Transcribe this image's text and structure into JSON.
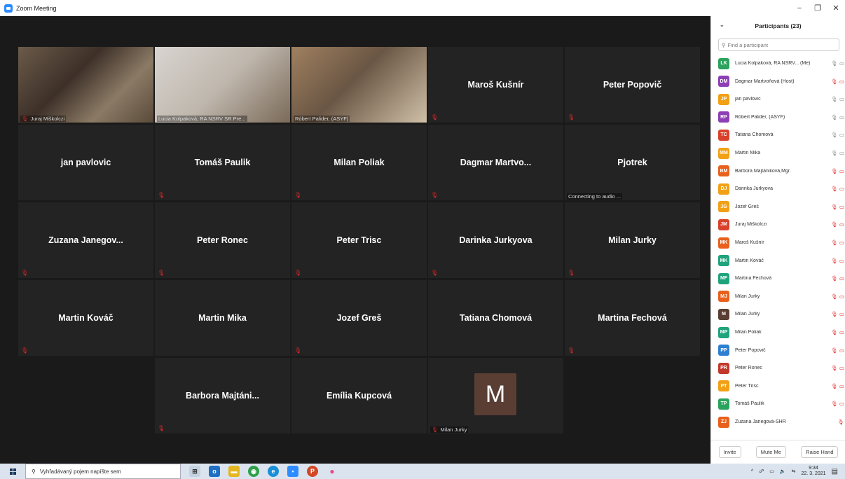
{
  "window": {
    "title": "Zoom Meeting"
  },
  "gallery": {
    "tiles": [
      {
        "kind": "video",
        "caption": "Juraj Miškolczi",
        "muted": true
      },
      {
        "kind": "video",
        "caption": "Lucia Kolpaková, RA NSRV SR Pre...",
        "muted": false
      },
      {
        "kind": "video",
        "caption": "Róbert Palider, (ASYF)",
        "muted": false,
        "active": true
      },
      {
        "kind": "name",
        "name": "Maroš Kušnír",
        "muted": true
      },
      {
        "kind": "name",
        "name": "Peter Popovič",
        "muted": true
      },
      {
        "kind": "name",
        "name": "jan pavlovic",
        "muted": false
      },
      {
        "kind": "name",
        "name": "Tomáš Paulik",
        "muted": true
      },
      {
        "kind": "name",
        "name": "Milan Poliak",
        "muted": true
      },
      {
        "kind": "name",
        "name": "Dagmar Martvo...",
        "muted": true
      },
      {
        "kind": "name",
        "name": "Pjotrek",
        "muted": false,
        "status": "Connecting to audio ..."
      },
      {
        "kind": "name",
        "name": "Zuzana Janegov...",
        "muted": true
      },
      {
        "kind": "name",
        "name": "Peter Ronec",
        "muted": true
      },
      {
        "kind": "name",
        "name": "Peter Trisc",
        "muted": true
      },
      {
        "kind": "name",
        "name": "Darinka Jurkyova",
        "muted": true
      },
      {
        "kind": "name",
        "name": "Milan Jurky",
        "muted": true
      },
      {
        "kind": "name",
        "name": "Martin Kováč",
        "muted": true
      },
      {
        "kind": "name",
        "name": "Martin Mika",
        "muted": false
      },
      {
        "kind": "name",
        "name": "Jozef Greš",
        "muted": true
      },
      {
        "kind": "name",
        "name": "Tatiana Chomová",
        "muted": false
      },
      {
        "kind": "name",
        "name": "Martina Fechová",
        "muted": true
      },
      {
        "kind": "name",
        "name": "Barbora Majtáni...",
        "muted": true
      },
      {
        "kind": "name",
        "name": "Emília Kupcová",
        "muted": false
      },
      {
        "kind": "avatar",
        "letter": "M",
        "caption": "Milan Jurky",
        "muted": true
      }
    ]
  },
  "participants": {
    "title": "Participants (23)",
    "search_placeholder": "Find a participant",
    "list": [
      {
        "initials": "LK",
        "color": "#2aa35c",
        "name": "Lucia Kolpaková, RA NSRV... (Me)",
        "icons": "🎙 ▭",
        "muted": false
      },
      {
        "initials": "DM",
        "color": "#8e3fb5",
        "name": "Dagmar Martvoňová (Host)",
        "icons": "🎙 ▭",
        "muted": true
      },
      {
        "initials": "JP",
        "color": "#f2a016",
        "name": "jan pavlovic",
        "icons": "🎙 ▭",
        "muted": false
      },
      {
        "initials": "RP",
        "color": "#8e3fb5",
        "name": "Róbert Palider, (ASYF)",
        "icons": "🎙 ▭",
        "muted": false
      },
      {
        "initials": "TC",
        "color": "#d9412b",
        "name": "Tatiana Chomová",
        "icons": "🎙 ▭",
        "muted": false
      },
      {
        "initials": "MM",
        "color": "#f2a016",
        "name": "Martin Mika",
        "icons": "🎙 ▭",
        "muted": false
      },
      {
        "initials": "BM",
        "color": "#e8601c",
        "name": "Barbora Majtániková,Mgr.",
        "icons": "🎙 ▭",
        "muted": true
      },
      {
        "initials": "DJ",
        "color": "#f2a016",
        "name": "Darinka Jurkyova",
        "icons": "🎙 ▭",
        "muted": true
      },
      {
        "initials": "JG",
        "color": "#f2a016",
        "name": "Jozef Greš",
        "icons": "🎙 ▭",
        "muted": true
      },
      {
        "initials": "JM",
        "color": "#d9412b",
        "name": "Juraj Miškolczi",
        "icons": "🎙 ▭",
        "muted": true
      },
      {
        "initials": "MK",
        "color": "#e8601c",
        "name": "Maroš Kušnír",
        "icons": "🎙 ▭",
        "muted": true
      },
      {
        "initials": "MK",
        "color": "#1fa37c",
        "name": "Martin Kováč",
        "icons": "🎙 ▭",
        "muted": true
      },
      {
        "initials": "MF",
        "color": "#1fa37c",
        "name": "Martina Fechová",
        "icons": "🎙 ▭",
        "muted": true
      },
      {
        "initials": "MJ",
        "color": "#e8601c",
        "name": "Milan Jurky",
        "icons": "🎙 ▭",
        "muted": true
      },
      {
        "initials": "M",
        "color": "#5a3e34",
        "name": "Milan Jurky",
        "icons": "🎙 ▭",
        "muted": true
      },
      {
        "initials": "MP",
        "color": "#1fa37c",
        "name": "Milan Poliak",
        "icons": "🎙 ▭",
        "muted": true
      },
      {
        "initials": "PP",
        "color": "#2e7fd1",
        "name": "Peter Popovič",
        "icons": "🎙 ▭",
        "muted": true
      },
      {
        "initials": "PR",
        "color": "#c0392b",
        "name": "Peter Ronec",
        "icons": "🎙 ▭",
        "muted": true
      },
      {
        "initials": "PT",
        "color": "#f2a016",
        "name": "Peter Trisc",
        "icons": "🎙 ▭",
        "muted": true
      },
      {
        "initials": "TP",
        "color": "#2aa35c",
        "name": "Tomáš Paulik",
        "icons": "🎙 ▭",
        "muted": true
      },
      {
        "initials": "ZJ",
        "color": "#e8601c",
        "name": "Zuzana Janegová-SHR",
        "icons": "🎙",
        "muted": true
      }
    ],
    "buttons": {
      "invite": "Invite",
      "mute_me": "Mute Me",
      "raise_hand": "Raise Hand"
    }
  },
  "taskbar": {
    "search_placeholder": "Vyhľadávaný pojem napíšte sem",
    "time": "9:34",
    "date": "22. 3. 2021"
  }
}
